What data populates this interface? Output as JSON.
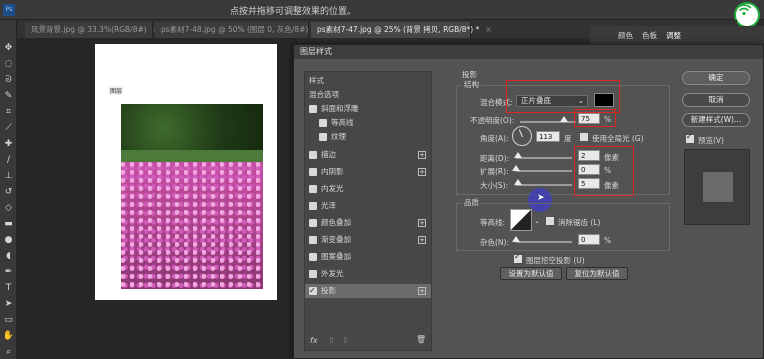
{
  "app": {
    "title": "点按并拖移可调整效果的位置。"
  },
  "tabs": [
    {
      "label": "风景背景.jpg @ 33.3%(RGB/8#)"
    },
    {
      "label": "ps素材7-48.jpg @ 50% (图层 0, 灰色/8#) *"
    },
    {
      "label": "ps素材7-47.jpg @ 25% (背景 拷贝, RGB/8*) *"
    }
  ],
  "tab_close": "×",
  "canvas": {
    "corner_label": "图层"
  },
  "dialog": {
    "title": "图层样式",
    "list": {
      "styles_header": "样式",
      "blend_options": "混合选项",
      "items": [
        {
          "label": "斜面和浮雕",
          "checked": false,
          "plus": false
        },
        {
          "label": "等高线",
          "checked": false,
          "plus": false
        },
        {
          "label": "纹理",
          "checked": false,
          "plus": false
        },
        {
          "label": "描边",
          "checked": false,
          "plus": true
        },
        {
          "label": "内阴影",
          "checked": false,
          "plus": true
        },
        {
          "label": "内发光",
          "checked": false,
          "plus": false
        },
        {
          "label": "光泽",
          "checked": false,
          "plus": false
        },
        {
          "label": "颜色叠加",
          "checked": false,
          "plus": true
        },
        {
          "label": "渐变叠加",
          "checked": false,
          "plus": true
        },
        {
          "label": "图案叠加",
          "checked": false,
          "plus": false
        },
        {
          "label": "外发光",
          "checked": false,
          "plus": false
        },
        {
          "label": "投影",
          "checked": true,
          "plus": true
        }
      ],
      "plus_sign": "+",
      "footer_fx": "fx",
      "footer_up": "⇧",
      "footer_down": "⇩",
      "footer_trash": "🗑"
    },
    "shadow": {
      "section_title": "投影",
      "structure": "结构",
      "blend_mode_label": "混合模式:",
      "blend_mode_value": "正片叠底",
      "shadow_color": "#000000",
      "opacity_label": "不透明度(O):",
      "opacity_value": "75",
      "percent": "%",
      "angle_label": "角度(A):",
      "angle_value": "113",
      "degree": "度",
      "global_light": "使用全局光 (G)",
      "distance_label": "距离(D):",
      "distance_value": "2",
      "spread_label": "扩展(R):",
      "spread_value": "0",
      "size_label": "大小(S):",
      "size_value": "5",
      "px": "像素",
      "quality": "品质",
      "contour_label": "等高线:",
      "antialias": "消除锯齿 (L)",
      "noise_label": "杂色(N):",
      "noise_value": "0",
      "knockout": "图层挖空投影 (U)",
      "set_default": "设置为默认值",
      "reset_default": "复位为默认值"
    },
    "buttons": {
      "ok": "确定",
      "cancel": "取消",
      "new_style": "新建样式(W)...",
      "preview": "预览(V)"
    }
  },
  "right_panel": {
    "tab1": "颜色",
    "tab2": "色板",
    "tab3": "调整"
  }
}
